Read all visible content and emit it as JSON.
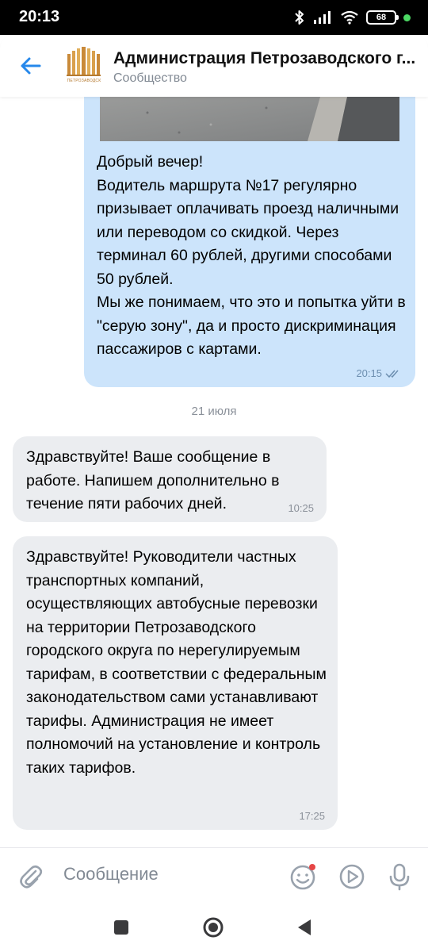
{
  "status_bar": {
    "time": "20:13",
    "battery": "68",
    "icons": [
      "bluetooth-icon",
      "signal-icon",
      "wifi-icon",
      "battery-icon"
    ],
    "dot_color": "#4cd964"
  },
  "header": {
    "title": "Администрация Петрозаводского г...",
    "subtitle": "Сообщество",
    "logo_caption": "ПЕТРОЗАВОДСК",
    "accent": "#2688eb"
  },
  "messages": {
    "outgoing": {
      "text": "Добрый вечер!\nВодитель маршрута №17 регулярно призывает оплачивать проезд наличными или переводом со скидкой. Через терминал 60 рублей, другими способами 50 рублей.\nМы же понимаем, что это и попытка уйти в \"серую зону\", да и просто дискриминация пассажиров с картами.",
      "time": "20:15",
      "status": "read"
    },
    "date_separator": "21 июля",
    "incoming": [
      {
        "text": "Здравствуйте! Ваше сообщение в работе. Напишем дополнительно в течение пяти рабочих дней.",
        "time": "10:25"
      },
      {
        "text": "Здравствуйте! Руководители частных транспортных компаний, осуществляющих автобусные перевозки на территории Петрозаводского городского округа по нерегулируемым тарифам, в соответствии с федеральным законодательством сами устанавливают тарифы. Администрация не имеет полномочий на установление и контроль таких тарифов.",
        "time": "17:25"
      }
    ]
  },
  "composer": {
    "placeholder": "Сообщение",
    "icons": [
      "attach-icon",
      "emoji-icon",
      "video-message-icon",
      "microphone-icon"
    ]
  },
  "navigation": {
    "icons": [
      "recents-icon",
      "home-icon",
      "back-icon"
    ]
  },
  "colors": {
    "outgoing_bubble": "#cce4fb",
    "incoming_bubble": "#ebedf0",
    "secondary_text": "#828a94",
    "icon_gray": "#99a2ad"
  }
}
